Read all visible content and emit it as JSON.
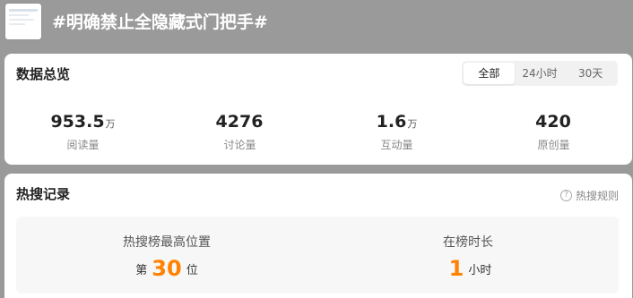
{
  "header": {
    "title": "#明确禁止全隐藏式门把手#"
  },
  "overview": {
    "title": "数据总览",
    "tabs": [
      {
        "label": "全部",
        "active": true
      },
      {
        "label": "24小时",
        "active": false
      },
      {
        "label": "30天",
        "active": false
      }
    ],
    "stats": [
      {
        "value": "953.5",
        "unit": "万",
        "label": "阅读量"
      },
      {
        "value": "4276",
        "unit": "",
        "label": "讨论量"
      },
      {
        "value": "1.6",
        "unit": "万",
        "label": "互动量"
      },
      {
        "value": "420",
        "unit": "",
        "label": "原创量"
      }
    ]
  },
  "hot_search": {
    "title": "热搜记录",
    "rule_link": "热搜规则",
    "help_icon": "?",
    "peak": {
      "label": "热搜榜最高位置",
      "prefix": "第",
      "value": "30",
      "suffix": "位"
    },
    "duration": {
      "label": "在榜时长",
      "value": "1",
      "suffix": "小时"
    }
  },
  "colors": {
    "accent": "#ff8200",
    "background": "#9a9a9a"
  }
}
